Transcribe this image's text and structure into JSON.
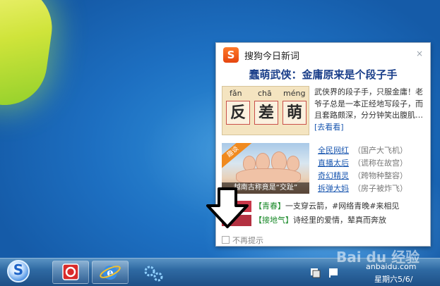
{
  "popup": {
    "title": "搜狗今日新词",
    "close": "×",
    "logo_letter": "S",
    "headline": "蠢萌武侠：金庸原来是个段子手",
    "feature": {
      "pinyin": [
        "fǎn",
        "chā",
        "méng"
      ],
      "hanzi": [
        "反",
        "差",
        "萌"
      ],
      "text": "武侠界的段子手，只服金庸！老爷子总是一本正经地写段子，而且套路颇深，分分钟笑出腹肌…",
      "more": "[去看看]"
    },
    "news_image": {
      "badge": "趣谈",
      "caption": "越南古称竟是“交趾”"
    },
    "news": [
      {
        "link": "全民网红",
        "note": "（国产大飞机）"
      },
      {
        "link": "直播太后",
        "note": "（谎称在故宫）"
      },
      {
        "link": "奇幻精灵",
        "note": "（跨物种整容）"
      },
      {
        "link": "拆弹大妈",
        "note": "（房子被炸飞）"
      }
    ],
    "bottom": [
      {
        "tag": "【青春】",
        "text": "一支穿云箭，#网络青晚#来相见"
      },
      {
        "tag": "【接地气】",
        "text": "诗经里的爱情，辇真而奔放"
      }
    ],
    "no_remind": "不再提示"
  },
  "tray": {
    "time": "anbaidu.com",
    "date": "星期六5/6/"
  },
  "watermark": {
    "text": "Bai du 经验"
  },
  "colors": {
    "taskbar": "#2f6aa3",
    "link": "#1a57b0",
    "headline": "#1b3f8a",
    "sogou": "#e5450f"
  },
  "icons": {
    "start": "sogou-s-icon",
    "app1": "red-app-icon",
    "app2": "ie-icon",
    "app3": "gear-icon",
    "tray": "network-icon"
  }
}
